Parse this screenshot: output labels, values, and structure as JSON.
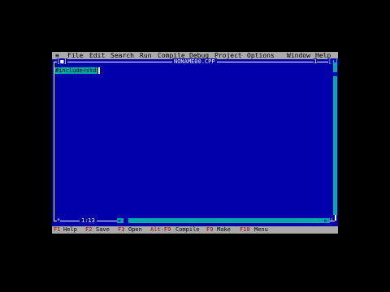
{
  "menu": {
    "system_label": "≡",
    "items": [
      {
        "label": "File"
      },
      {
        "label": "Edit"
      },
      {
        "label": "Search"
      },
      {
        "label": "Run"
      },
      {
        "label": "Compile"
      },
      {
        "label": "Debug"
      },
      {
        "label": "Project"
      },
      {
        "label": "Options"
      },
      {
        "label": "Window"
      },
      {
        "label": "Help"
      }
    ]
  },
  "editor": {
    "title": "NONAME00.CPP",
    "close_glyph": "[■]",
    "window_number": "1",
    "zoom_glyph": "[↕]",
    "code_line": "#include<std",
    "position": "1:13",
    "modified_indicator": "*",
    "scroll_left_arrow": "◄",
    "scroll_right_arrow": "►",
    "resize_glyph": "┘"
  },
  "status": {
    "items": [
      {
        "key": "F1",
        "label": "Help"
      },
      {
        "key": "F2",
        "label": "Save"
      },
      {
        "key": "F3",
        "label": "Open"
      },
      {
        "key": "Alt-F9",
        "label": "Compile"
      },
      {
        "key": "F9",
        "label": "Make"
      },
      {
        "key": "F10",
        "label": "Menu"
      }
    ]
  },
  "colors": {
    "editor_bg": "#0000aa",
    "menubar_bg": "#aaaaaa",
    "hotkey": "#aa0000",
    "selection": "#00aaaa",
    "cursor": "#ffff55"
  }
}
